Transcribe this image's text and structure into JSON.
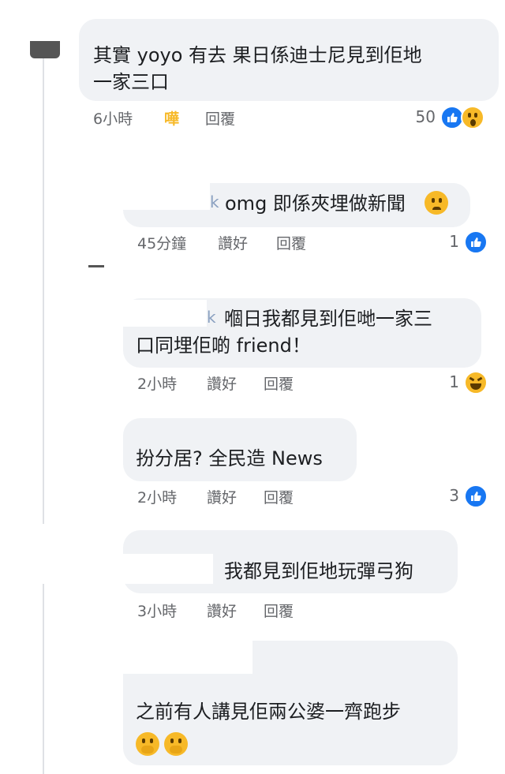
{
  "comments": [
    {
      "text_line1": "其實 yoyo 有去 果日係迪士尼見到佢地",
      "text_line2": "一家三口",
      "time": "6小時",
      "reaction": "嘩",
      "reply": "回覆",
      "count": "50",
      "icons": [
        "like-icon",
        "wow-emoji-icon"
      ]
    },
    {
      "name_tail": "k",
      "text_line1": "omg 即係夾埋做新聞",
      "emoji": "frowning-emoji",
      "time": "45分鐘",
      "like": "讚好",
      "reply": "回覆",
      "count": "1",
      "icons": [
        "like-icon"
      ]
    },
    {
      "name_tail": "k",
      "text_line1": "嗰日我都見到佢哋一家三",
      "text_line2": "口同埋佢啲 friend！",
      "time": "2小時",
      "like": "讚好",
      "reply": "回覆",
      "count": "1",
      "icons": [
        "laughing-emoji-icon"
      ]
    },
    {
      "text_line1": "扮分居? 全民造 News",
      "time": "2小時",
      "like": "讚好",
      "reply": "回覆",
      "count": "3",
      "icons": [
        "like-icon"
      ]
    },
    {
      "text_line1": "我都見到佢地玩彈弓狗",
      "time": "3小時",
      "like": "讚好",
      "reply": "回覆"
    },
    {
      "text_line1": "之前有人講見佢兩公婆一齊跑步",
      "emojis": [
        "hand-over-mouth-emoji",
        "hand-over-mouth-emoji"
      ]
    }
  ],
  "colors": {
    "bubble": "#f0f2f5",
    "meta_text": "#65676b",
    "like_blue": "#1877f2",
    "emoji_yellow": "#f7b928",
    "wah_orange": "#f7b928"
  }
}
